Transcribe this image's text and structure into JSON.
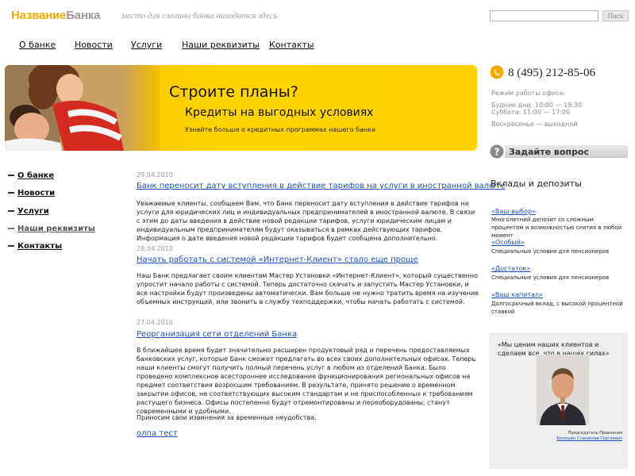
{
  "header": {
    "logo_part1": "Название",
    "logo_part2": "Банка",
    "slogan": "место для слогана банка находится здесь",
    "search_value": "",
    "search_button": "Писк"
  },
  "topnav": [
    "О банке",
    "Новости",
    "Услуги",
    "Наши реквизиты",
    "Контакты"
  ],
  "banner": {
    "title": "Строите планы?",
    "subtitle": "Кредиты на выгодных условиях",
    "note": "Узнайте больше о кредитных программах нашего банка"
  },
  "contact": {
    "phone": "8 (495) 212-85-06",
    "hours_title": "Режим работы офиса:",
    "weekdays": "Будние дни: 10:00 — 19:30",
    "saturday": "Суббота: 11:00 — 17:00",
    "sunday": "Воскресенье — выходной",
    "ask_label": "Задайте вопрос"
  },
  "sidebar": [
    "О банке",
    "Новости",
    "Услуги",
    "Наши реквизиты",
    "Контакты"
  ],
  "news": [
    {
      "date": "29.04.2010",
      "title": "Банк переносит дату вступления в действие тарифов на услуги в иностранной валюте",
      "body": "Уважаемые клиенты, сообщаем Вам, что Банк переносит дату вступления в действие тарифов на услуги для юридических лиц и индивидуальных предпринимателей в иностранной валюте. В связи с этим до даты введения в действие новой редакции тарифов, услуги юридическим лицам и индивидуальным предпринимателям будут оказываться в рамках действующих тарифов. Информация о дате введения новой редакции тарифов будет сообщена дополнительно."
    },
    {
      "date": "28.04.2010",
      "title": "Начать работать с системой «Интернет-Клиент» стало еще проще",
      "body": "Наш Банк предлагает своим клиентам Мастер Установки «Интернет-Клиент», который существенно упростит начало работы с системой. Теперь достаточно скачать и запустить Мастер Установки, и все настройки будут произведены автоматически. Вам больше не нужно тратить время на изучение объемных инструкций, или звонить в службу техподдержки, чтобы начать работать с системой."
    },
    {
      "date": "27.04.2010",
      "title": "Реорганизация сети отделений Банка",
      "body": "В ближайшее время будет значительно расширен продуктовый ряд и перечень предоставляемых банковских услуг, которые Банк сможет предлагать во всех своих дополнительных офисах. Теперь наши клиенты смогут получить полный перечень услуг в любом из отделений Банка. Было проведено комплексное всестороннее исследование функционирования региональных офисов на предмет соответствия возросшим требованиям. В результате, принято решение о временном закрытии офисов, не соответствующих высоким стандартам и не приспособленных к требованиям растущего бизнеса. Офисы постепенно будут отремонтированы и переоборудованы, станут современными и удобными.",
      "body2": "Приносим свои извинения за временные неудобства."
    }
  ],
  "more_link": "олпа тест",
  "deposits": {
    "title": "Вклады и депозиты",
    "items": [
      {
        "name": "«Ваш выбор»",
        "desc": "Многолетний депозит со сложным процентом и возможностью снятия в любой момент"
      },
      {
        "name": "«Особый»",
        "desc": "Специальные условия для пенсионеров"
      },
      {
        "name": "«Достаток»",
        "desc": "Специальные условия для пенсионеров"
      },
      {
        "name": "«Ваш капитал»",
        "desc": "Долгосрочный вклад, с высокой процентной ставкой"
      }
    ]
  },
  "quote": {
    "text": "«Мы ценим наших клиентов и сделаем все, что в наших силах»",
    "caption_role": "Председатель Правления",
    "caption_name": "Болошин Станислав Сергеевич"
  },
  "colors": {
    "accent_yellow": "#ffd400",
    "logo_orange": "#f5a800",
    "link_blue": "#1a52b8"
  }
}
